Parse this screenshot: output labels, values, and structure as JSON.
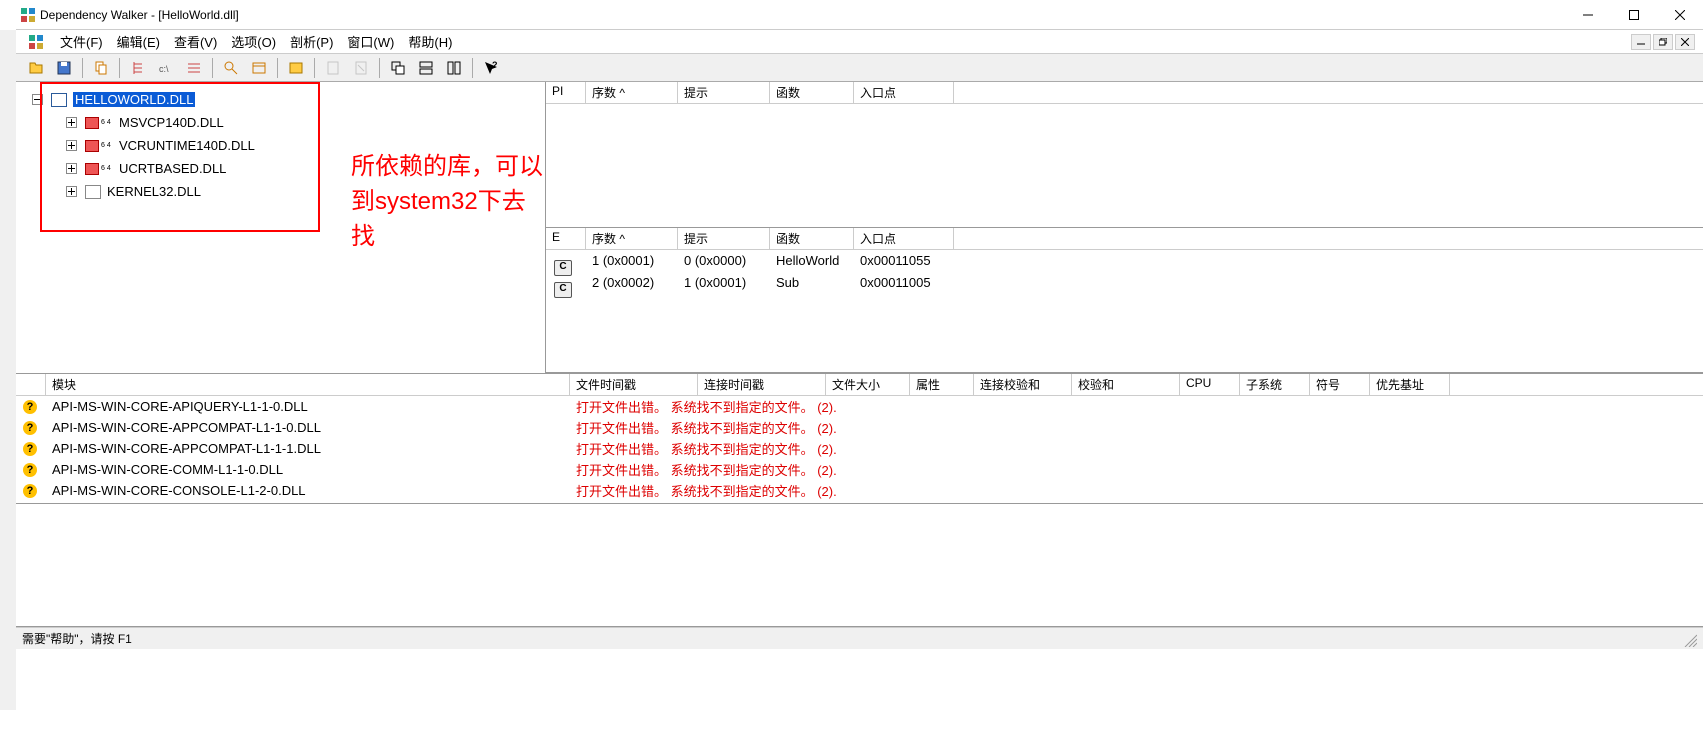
{
  "title": "Dependency Walker - [HelloWorld.dll]",
  "menu": {
    "file": "文件(F)",
    "edit": "编辑(E)",
    "view": "查看(V)",
    "options": "选项(O)",
    "profile": "剖析(P)",
    "window": "窗口(W)",
    "help": "帮助(H)"
  },
  "tree": {
    "root": "HELLOWORLD.DLL",
    "children": [
      "MSVCP140D.DLL",
      "VCRUNTIME140D.DLL",
      "UCRTBASED.DLL",
      "KERNEL32.DLL"
    ]
  },
  "annotation": "所依赖的库，可以到system32下去找",
  "import_cols": {
    "pi": "PI",
    "ord": "序数 ^",
    "hint": "提示",
    "func": "函数",
    "entry": "入口点"
  },
  "export_cols": {
    "e": "E",
    "ord": "序数 ^",
    "hint": "提示",
    "func": "函数",
    "entry": "入口点"
  },
  "exports": [
    {
      "ord": "1 (0x0001)",
      "hint": "0 (0x0000)",
      "func": "HelloWorld",
      "entry": "0x00011055"
    },
    {
      "ord": "2 (0x0002)",
      "hint": "1 (0x0001)",
      "func": "Sub",
      "entry": "0x00011005"
    }
  ],
  "mod_cols": {
    "icon": "",
    "mod": "模块",
    "fts": "文件时间戳",
    "lts": "连接时间戳",
    "fsize": "文件大小",
    "attr": "属性",
    "linkcs": "连接校验和",
    "cs": "校验和",
    "cpu": "CPU",
    "sub": "子系统",
    "sym": "符号",
    "base": "优先基址"
  },
  "modules": [
    {
      "name": "API-MS-WIN-CORE-APIQUERY-L1-1-0.DLL",
      "err": "打开文件出错。 系统找不到指定的文件。 (2)."
    },
    {
      "name": "API-MS-WIN-CORE-APPCOMPAT-L1-1-0.DLL",
      "err": "打开文件出错。 系统找不到指定的文件。 (2)."
    },
    {
      "name": "API-MS-WIN-CORE-APPCOMPAT-L1-1-1.DLL",
      "err": "打开文件出错。 系统找不到指定的文件。 (2)."
    },
    {
      "name": "API-MS-WIN-CORE-COMM-L1-1-0.DLL",
      "err": "打开文件出错。 系统找不到指定的文件。 (2)."
    },
    {
      "name": "API-MS-WIN-CORE-CONSOLE-L1-2-0.DLL",
      "err": "打开文件出错。 系统找不到指定的文件。 (2)."
    }
  ],
  "status": "需要\"帮助\"，请按 F1"
}
